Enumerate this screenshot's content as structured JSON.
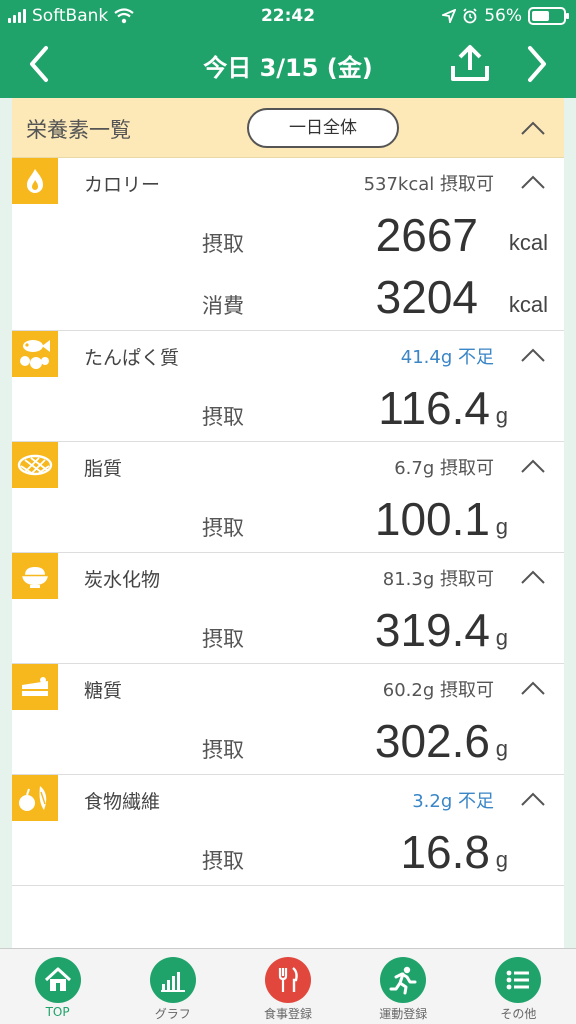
{
  "status_bar": {
    "carrier": "SoftBank",
    "time": "22:42",
    "battery": "56%",
    "battery_level": 0.56
  },
  "nav": {
    "title": "今日 3/15 (金)"
  },
  "summary": {
    "title": "栄養素一覧",
    "range_button": "一日全体"
  },
  "sections": [
    {
      "name": "カロリー",
      "status": "537kcal 摂取可",
      "status_kind": "ok",
      "icon": "flame-icon",
      "rows": [
        {
          "label": "摂取",
          "value": "2667",
          "unit": "kcal"
        },
        {
          "label": "消費",
          "value": "3204",
          "unit": "kcal"
        }
      ]
    },
    {
      "name": "たんぱく質",
      "status": "41.4g 不足",
      "status_kind": "short",
      "icon": "fish-egg-icon",
      "rows": [
        {
          "label": "摂取",
          "value": "116.4",
          "unit": "g"
        }
      ]
    },
    {
      "name": "脂質",
      "status": "6.7g 摂取可",
      "status_kind": "ok",
      "icon": "fat-icon",
      "rows": [
        {
          "label": "摂取",
          "value": "100.1",
          "unit": "g"
        }
      ]
    },
    {
      "name": "炭水化物",
      "status": "81.3g 摂取可",
      "status_kind": "ok",
      "icon": "rice-bowl-icon",
      "rows": [
        {
          "label": "摂取",
          "value": "319.4",
          "unit": "g"
        }
      ]
    },
    {
      "name": "糖質",
      "status": "60.2g 摂取可",
      "status_kind": "ok",
      "icon": "cake-icon",
      "rows": [
        {
          "label": "摂取",
          "value": "302.6",
          "unit": "g"
        }
      ]
    },
    {
      "name": "食物繊維",
      "status": "3.2g 不足",
      "status_kind": "short",
      "icon": "vegetable-icon",
      "rows": [
        {
          "label": "摂取",
          "value": "16.8",
          "unit": "g"
        }
      ]
    }
  ],
  "tabs": [
    {
      "label": "TOP",
      "icon": "home-icon",
      "active": true
    },
    {
      "label": "グラフ",
      "icon": "graph-icon"
    },
    {
      "label": "食事登録",
      "icon": "meal-icon"
    },
    {
      "label": "運動登録",
      "icon": "runner-icon"
    },
    {
      "label": "その他",
      "icon": "list-icon"
    }
  ],
  "colors": {
    "brand": "#1fa36a",
    "accent": "#f7b81e",
    "short": "#3a86c7",
    "summary_bg": "#fde9b8",
    "meal": "#e2473d"
  }
}
